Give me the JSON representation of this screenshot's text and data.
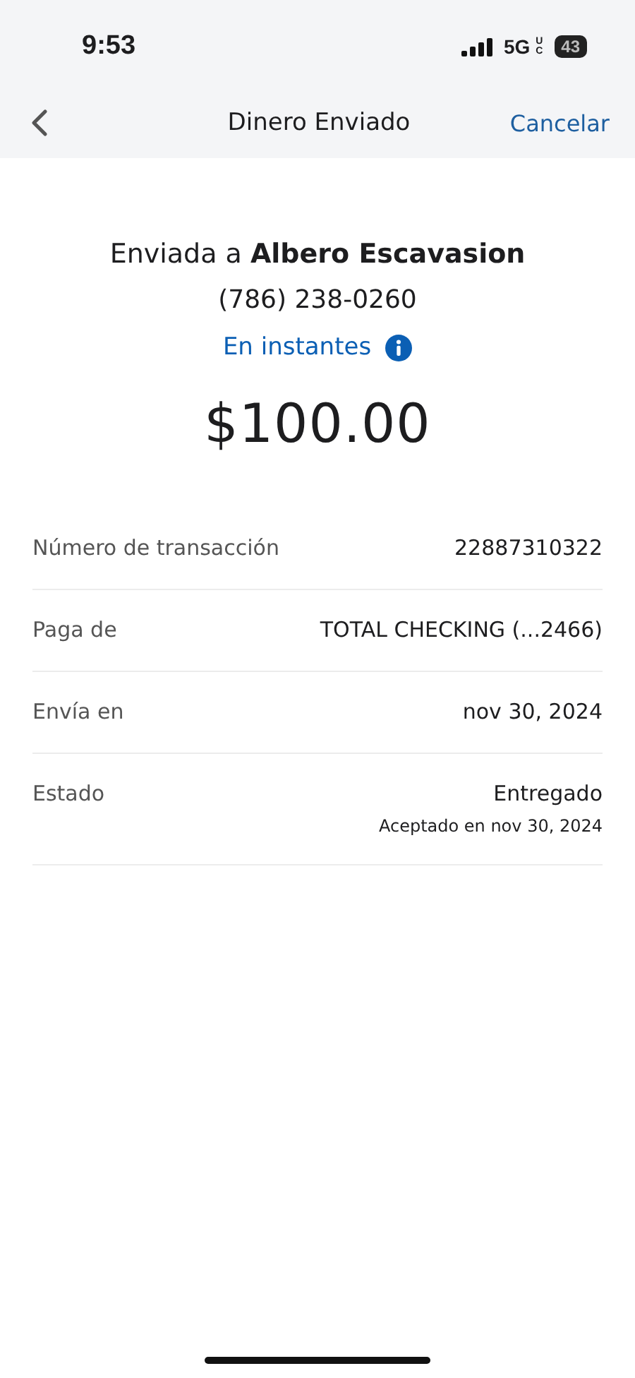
{
  "status_bar": {
    "time": "9:53",
    "network": "5G",
    "network_sub": "UC",
    "battery": "43"
  },
  "nav": {
    "title": "Dinero Enviado",
    "action": "Cancelar"
  },
  "summary": {
    "recipient": "Enviada a **Albero Escavasion**",
    "phone": "(786) 238-0260",
    "speed": "En instantes",
    "amount": "$100.00"
  },
  "details": [
    {
      "label": "Número de transacción",
      "value": "22887310322"
    },
    {
      "label": "Paga de",
      "value": "TOTAL CHECKING (...2466)"
    },
    {
      "label": "Envía en",
      "value": "nov 30, 2024"
    },
    {
      "label": "Estado",
      "value": "Entregado",
      "note": "Aceptado en nov 30, 2024"
    }
  ]
}
